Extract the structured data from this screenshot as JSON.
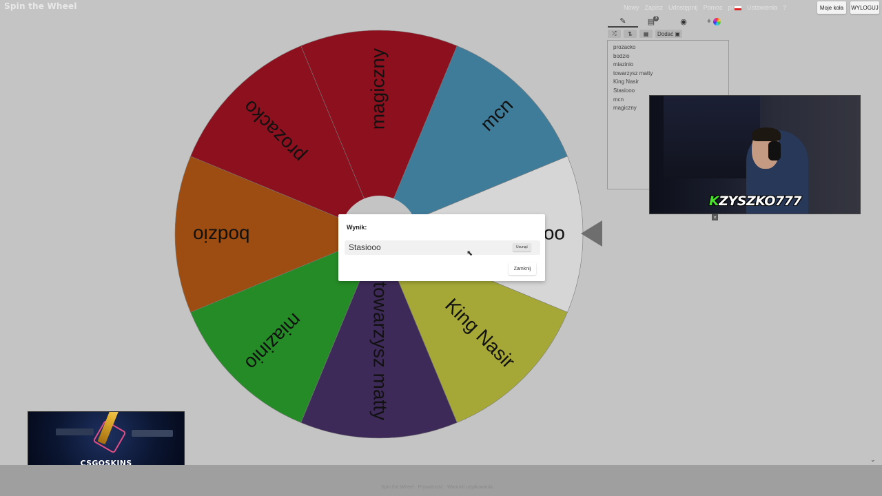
{
  "app": {
    "title": "Spin the Wheel"
  },
  "topnav": {
    "items": [
      "Nowy",
      "Zapisz",
      "Udostępnij",
      "Pomoc",
      "pl",
      "Ustawienia",
      "?"
    ],
    "moje_kola": "Moje koła",
    "wyloguj": "WYLOGUJ"
  },
  "editor": {
    "tabs": [
      {
        "icon": "pencil-icon",
        "glyph": "✎"
      },
      {
        "icon": "clipboard-icon",
        "glyph": "📋",
        "badge": "3"
      },
      {
        "icon": "eye-off-icon",
        "glyph": "◉"
      },
      {
        "icon": "add-color-icon",
        "glyph": "+"
      }
    ],
    "toolbar": {
      "shuffle": "⤮",
      "sort": "⇅",
      "image": "▦",
      "add_label": "Dodać"
    },
    "entries": [
      "prozacko",
      "bodzio",
      "miazinio",
      "towarzysz matty",
      "King Nasir",
      "Stasiooo",
      "mcn",
      "magiczny"
    ]
  },
  "wheel": {
    "segments": [
      {
        "label": "Stasiooo",
        "color": "#d6d6d6"
      },
      {
        "label": "King Nasir",
        "color": "#a5a836"
      },
      {
        "label": "towarzysz matty",
        "color": "#3e2a58"
      },
      {
        "label": "miazinio",
        "color": "#258b26"
      },
      {
        "label": "bodzio",
        "color": "#9d4d11"
      },
      {
        "label": "prozacko",
        "color": "#8c101d"
      },
      {
        "label": "magiczny",
        "color": "#8c101d"
      },
      {
        "label": "mcn",
        "color": "#3f7c9a"
      }
    ]
  },
  "dialog": {
    "title": "Wynik:",
    "result": "Stasiooo",
    "remove_label": "Usunąć",
    "close_label": "Zamknij"
  },
  "webcam": {
    "name_first": "K",
    "name_rest": "ZYSZKO777"
  },
  "sponsor": {
    "logo": "CSGOSKINS"
  },
  "footer": {
    "text": "Spin the Wheel · Prywatność · Warunki użytkowania"
  }
}
